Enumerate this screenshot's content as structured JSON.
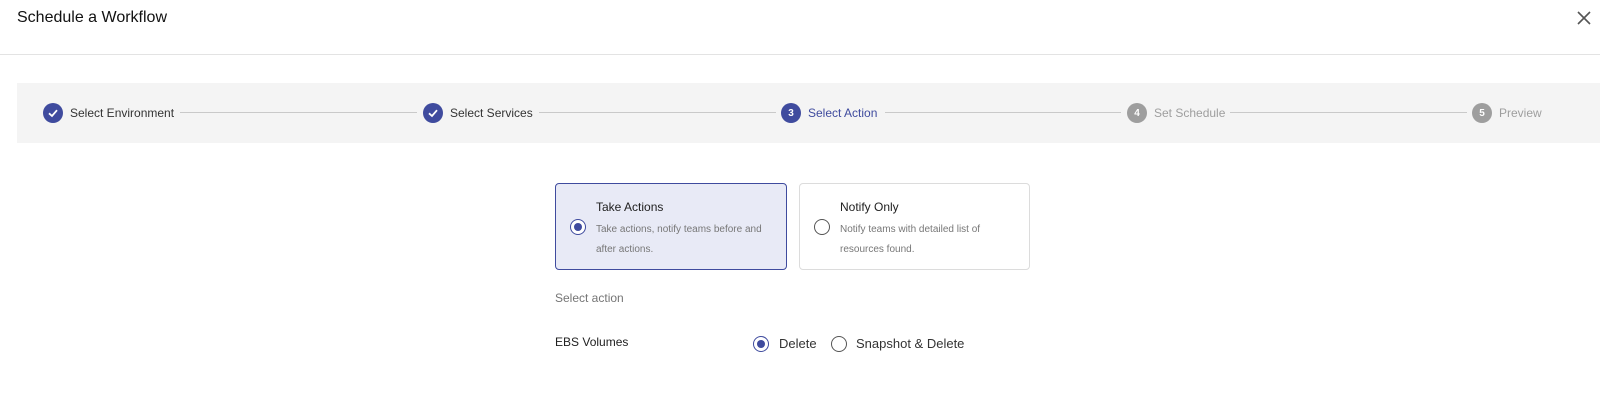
{
  "header": {
    "title": "Schedule a Workflow",
    "close_icon": "close-icon"
  },
  "stepper": {
    "steps": [
      {
        "number": "1",
        "label": "Select Environment",
        "state": "done"
      },
      {
        "number": "2",
        "label": "Select Services",
        "state": "done"
      },
      {
        "number": "3",
        "label": "Select Action",
        "state": "active"
      },
      {
        "number": "4",
        "label": "Set Schedule",
        "state": "todo"
      },
      {
        "number": "5",
        "label": "Preview",
        "state": "todo"
      }
    ]
  },
  "mode": {
    "options": [
      {
        "title": "Take Actions",
        "description": "Take actions, notify teams before and after actions.",
        "selected": true
      },
      {
        "title": "Notify Only",
        "description": "Notify teams with detailed list of resources found.",
        "selected": false
      }
    ]
  },
  "action": {
    "section_label": "Select action",
    "resource_label": "EBS Volumes",
    "choices": [
      {
        "label": "Delete",
        "selected": true
      },
      {
        "label": "Snapshot & Delete",
        "selected": false
      }
    ]
  },
  "colors": {
    "accent": "#3f4b9e",
    "selected_card_bg": "#e8eaf6",
    "stepper_bg": "#f4f4f4",
    "inactive_step": "#9e9e9e"
  }
}
